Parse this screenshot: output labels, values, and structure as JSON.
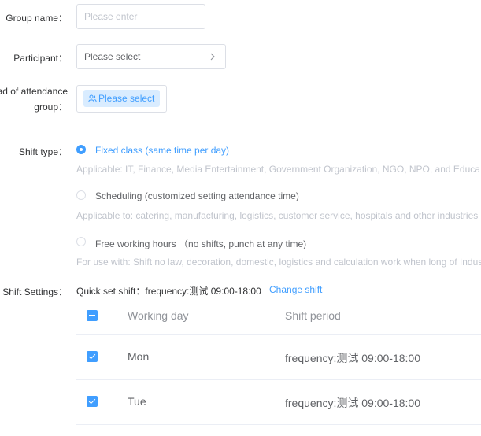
{
  "form": {
    "group_name": {
      "label": "Group name：",
      "placeholder": "Please enter"
    },
    "participant": {
      "label": "Participant：",
      "value": "Please select"
    },
    "head_of_attendance": {
      "label_line1": "ad of attendance",
      "label_line2": "group：",
      "button_label": "Please select"
    },
    "shift_type": {
      "label": "Shift type：",
      "options": [
        {
          "label": "Fixed class (same time per day)",
          "hint": "Applicable: IT, Finance, Media Entertainment, Government Organization, NGO, NPO, and Educa",
          "selected": true
        },
        {
          "label": "Scheduling (customized setting attendance time)",
          "hint": "Applicable to: catering, manufacturing, logistics, customer service, hospitals and other industries",
          "selected": false
        },
        {
          "label": "Free working hours （no shifts, punch at any time)",
          "hint": "For use with: Shift no law, decoration, domestic, logistics and calculation work when long of Indus",
          "selected": false
        }
      ]
    },
    "shift_settings": {
      "label": "Shift Settings：",
      "quick_set": "Quick set shift：frequency:测试  09:00-18:00",
      "change_link": "Change shift",
      "table": {
        "headers": [
          "Working day",
          "Shift period"
        ],
        "rows": [
          {
            "day": "Mon",
            "period": "frequency:测试 09:00-18:00",
            "checked": true
          },
          {
            "day": "Tue",
            "period": "frequency:测试 09:00-18:00",
            "checked": true
          }
        ]
      }
    }
  },
  "colors": {
    "accent": "#409eff",
    "border": "#dcdfe6",
    "hint": "#c0c4cc",
    "tag_bg": "#d9ecff"
  },
  "icons": {
    "select_arrow": "chevron-right-icon",
    "member_icon": "user-group-icon"
  }
}
